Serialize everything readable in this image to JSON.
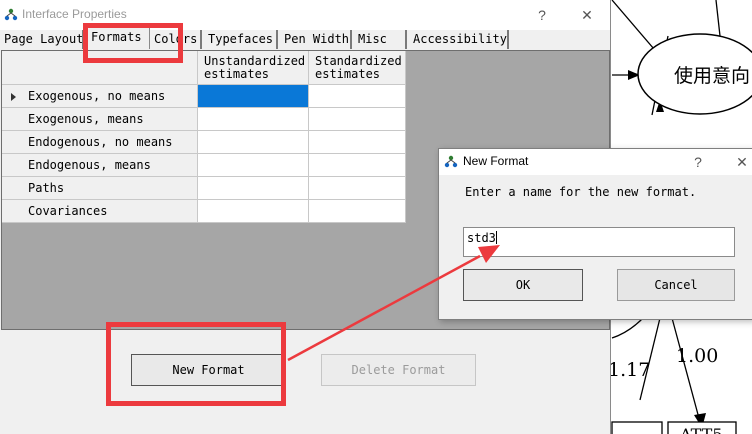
{
  "main_dialog": {
    "title": "Interface Properties",
    "controls": {
      "help": "?",
      "close": "✕"
    },
    "tabs": [
      {
        "label": "Page Layout"
      },
      {
        "label": "Formats"
      },
      {
        "label": "Colors"
      },
      {
        "label": "Typefaces"
      },
      {
        "label": "Pen Width"
      },
      {
        "label": "Misc"
      },
      {
        "label": "Accessibility"
      }
    ],
    "active_tab": "Formats",
    "grid": {
      "columns": [
        "Unstandardized\nestimates",
        "Standardized\nestimates"
      ],
      "rows": [
        "Exogenous, no means",
        "Exogenous, means",
        "Endogenous, no means",
        "Endogenous, means",
        "Paths",
        "Covariances"
      ]
    },
    "buttons": {
      "new_format": "New Format",
      "delete_format": "Delete Format"
    }
  },
  "new_format_dialog": {
    "title": "New Format",
    "controls": {
      "help": "?",
      "close": "✕"
    },
    "prompt": "Enter a name for the new format.",
    "input_value": "std3",
    "buttons": {
      "ok": "OK",
      "cancel": "Cancel"
    }
  },
  "background_diagram": {
    "node_label": "使用意向",
    "edge_labels": [
      "1.17",
      "1.00"
    ],
    "box_labels": [
      "ATT5"
    ]
  },
  "colors": {
    "annotation_red": "#ec3a3e",
    "selection_blue": "#0a78d7",
    "grid_background": "#a6a6a6"
  }
}
